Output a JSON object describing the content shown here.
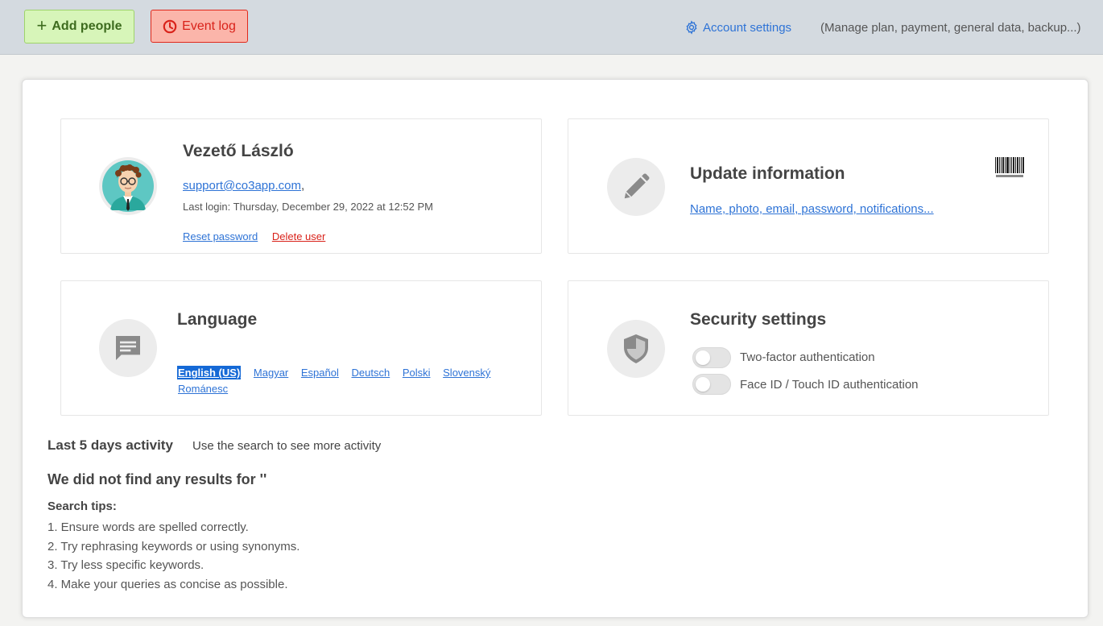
{
  "toolbar": {
    "add_people_label": "Add people",
    "event_log_label": "Event log",
    "account_settings_label": "Account settings",
    "account_settings_note": "(Manage plan, payment, general data, backup...)"
  },
  "profile": {
    "name": "Vezető László",
    "email": "support@co3app.com",
    "email_suffix": ",",
    "last_login": "Last login: Thursday, December 29, 2022 at 12:52 PM",
    "reset_password": "Reset password",
    "delete_user": "Delete user"
  },
  "update": {
    "title": "Update information",
    "link": "Name, photo, email, password, notifications..."
  },
  "language": {
    "title": "Language",
    "options": [
      "English (US)",
      "Magyar",
      "Español",
      "Deutsch",
      "Polski",
      "Slovenský",
      "Románesc"
    ],
    "selected": "English (US)"
  },
  "security": {
    "title": "Security settings",
    "two_factor": "Two-factor authentication",
    "face_id": "Face ID / Touch ID authentication"
  },
  "activity": {
    "title": "Last 5 days activity",
    "hint": "Use the search to see more activity",
    "no_results": "We did not find any results for ''",
    "tips_title": "Search tips:",
    "tips": [
      "1. Ensure words are spelled correctly.",
      "2. Try rephrasing keywords or using synonyms.",
      "3. Try less specific keywords.",
      "4. Make your queries as concise as possible."
    ]
  },
  "colors": {
    "accent": "#2e73d6",
    "danger": "#d9221a",
    "success": "#3d6b1e"
  }
}
